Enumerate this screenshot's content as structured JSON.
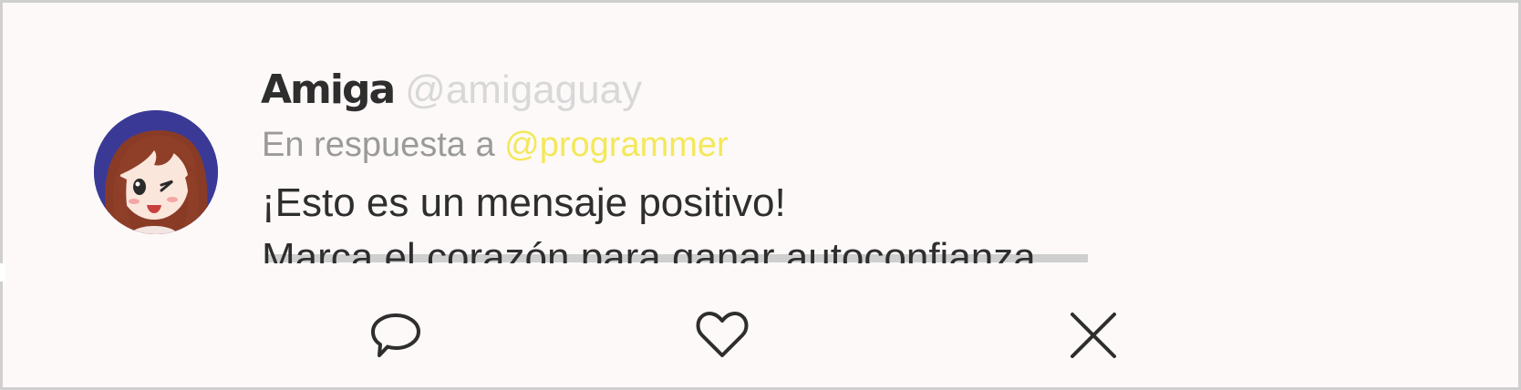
{
  "post": {
    "display_name": "Amiga",
    "handle": "@amigaguay",
    "reply_prefix": "En respuesta a",
    "reply_to": "@programmer",
    "message_line_1": "¡Esto es un mensaje positivo!",
    "message_line_2": "Marca el corazón para ganar autoconfianza."
  },
  "actions": {
    "reply_icon": "speech-bubble-icon",
    "like_icon": "heart-icon",
    "close_icon": "close-icon"
  },
  "colors": {
    "background": "#fdf9f8",
    "text": "#2e2e2e",
    "handle": "#d8d8d8",
    "reply_prefix": "#9a9a9a",
    "mention": "#f3e85a",
    "avatar_bg": "#3a3a96"
  }
}
